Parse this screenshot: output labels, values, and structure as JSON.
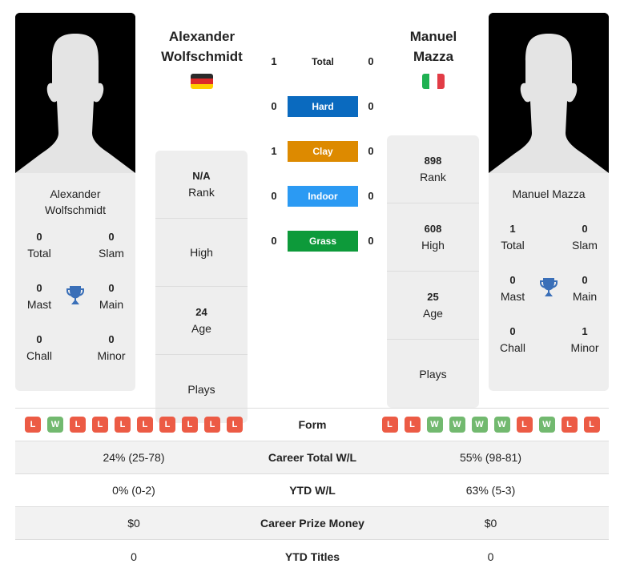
{
  "player1": {
    "header_name_line1": "Alexander",
    "header_name_line2": "Wolfschmidt",
    "card_name_line1": "Alexander",
    "card_name_line2": "Wolfschmidt",
    "flag": "germany-flag",
    "titles": {
      "total": {
        "value": "0",
        "label": "Total"
      },
      "slam": {
        "value": "0",
        "label": "Slam"
      },
      "mast": {
        "value": "0",
        "label": "Mast"
      },
      "main": {
        "value": "0",
        "label": "Main"
      },
      "chall": {
        "value": "0",
        "label": "Chall"
      },
      "minor": {
        "value": "0",
        "label": "Minor"
      }
    },
    "info": {
      "rank": {
        "value": "N/A",
        "label": "Rank"
      },
      "high": {
        "value": "",
        "label": "High"
      },
      "age": {
        "value": "24",
        "label": "Age"
      },
      "plays": {
        "value": "",
        "label": "Plays"
      }
    }
  },
  "player2": {
    "header_name_line1": "Manuel",
    "header_name_line2": "Mazza",
    "card_name_line1": "Manuel Mazza",
    "flag": "italy-flag",
    "titles": {
      "total": {
        "value": "1",
        "label": "Total"
      },
      "slam": {
        "value": "0",
        "label": "Slam"
      },
      "mast": {
        "value": "0",
        "label": "Mast"
      },
      "main": {
        "value": "0",
        "label": "Main"
      },
      "chall": {
        "value": "0",
        "label": "Chall"
      },
      "minor": {
        "value": "1",
        "label": "Minor"
      }
    },
    "info": {
      "rank": {
        "value": "898",
        "label": "Rank"
      },
      "high": {
        "value": "608",
        "label": "High"
      },
      "age": {
        "value": "25",
        "label": "Age"
      },
      "plays": {
        "value": "",
        "label": "Plays"
      }
    }
  },
  "h2h": {
    "total": {
      "label": "Total",
      "left": "1",
      "right": "0"
    },
    "surfaces": [
      {
        "label": "Hard",
        "left": "0",
        "right": "0",
        "color": "#0a6abf"
      },
      {
        "label": "Clay",
        "left": "1",
        "right": "0",
        "color": "#dd8a00"
      },
      {
        "label": "Indoor",
        "left": "0",
        "right": "0",
        "color": "#2b9af3"
      },
      {
        "label": "Grass",
        "left": "0",
        "right": "0",
        "color": "#0d9a3a"
      }
    ]
  },
  "stats": {
    "form_label": "Form",
    "form_left": [
      "L",
      "W",
      "L",
      "L",
      "L",
      "L",
      "L",
      "L",
      "L",
      "L"
    ],
    "form_right": [
      "L",
      "L",
      "W",
      "W",
      "W",
      "W",
      "L",
      "W",
      "L",
      "L"
    ],
    "rows": [
      {
        "label": "Career Total W/L",
        "left": "24% (25-78)",
        "right": "55% (98-81)"
      },
      {
        "label": "YTD W/L",
        "left": "0% (0-2)",
        "right": "63% (5-3)"
      },
      {
        "label": "Career Prize Money",
        "left": "$0",
        "right": "$0"
      },
      {
        "label": "YTD Titles",
        "left": "0",
        "right": "0"
      }
    ]
  },
  "colors": {
    "loss": "#ec5b45",
    "win": "#72b96f",
    "trophy": "#3a6fb8",
    "card_bg": "#eeeeee"
  }
}
